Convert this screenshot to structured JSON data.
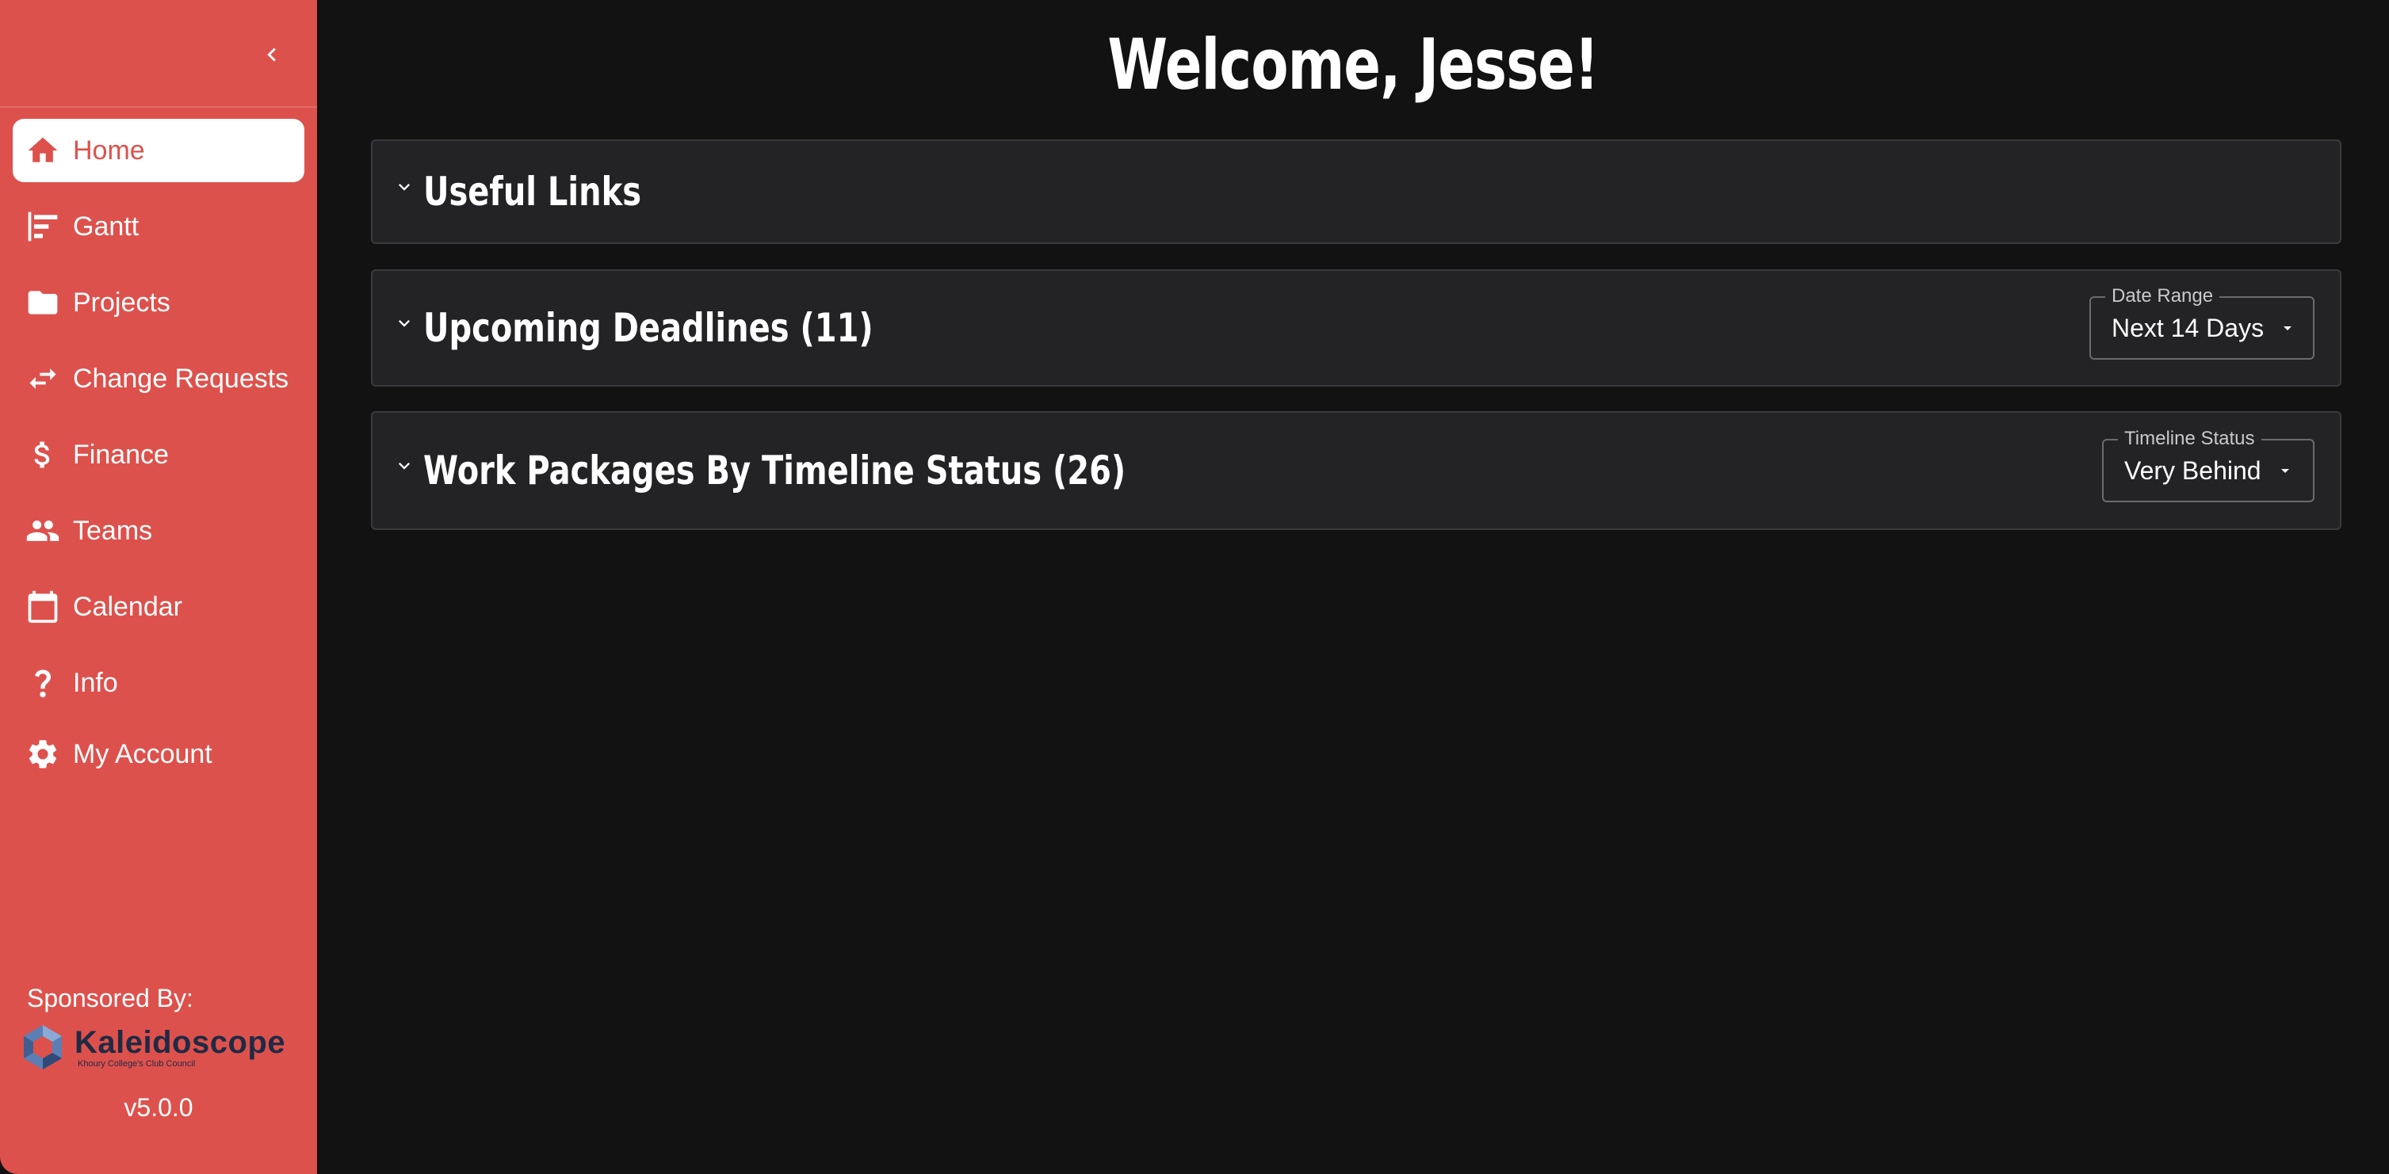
{
  "sidebar": {
    "items": [
      {
        "label": "Home",
        "icon": "home-icon",
        "active": true
      },
      {
        "label": "Gantt",
        "icon": "gantt-icon"
      },
      {
        "label": "Projects",
        "icon": "folder-icon"
      },
      {
        "label": "Change Requests",
        "icon": "swap-arrows-icon"
      },
      {
        "label": "Finance",
        "icon": "dollar-icon"
      },
      {
        "label": "Teams",
        "icon": "people-icon"
      },
      {
        "label": "Calendar",
        "icon": "calendar-icon"
      },
      {
        "label": "Info",
        "icon": "question-icon"
      },
      {
        "label": "My Account",
        "icon": "gear-icon"
      }
    ],
    "sponsor_label": "Sponsored By:",
    "sponsor_name": "Kaleidoscope",
    "sponsor_subtitle": "Khoury College's Club Council",
    "version": "v5.0.0"
  },
  "main": {
    "title": "Welcome, Jesse!",
    "sections": [
      {
        "title": "Useful Links"
      },
      {
        "title": "Upcoming Deadlines (11)",
        "select": {
          "legend": "Date Range",
          "value": "Next 14 Days"
        }
      },
      {
        "title": "Work Packages By Timeline Status (26)",
        "select": {
          "legend": "Timeline Status",
          "value": "Very Behind"
        }
      }
    ]
  },
  "colors": {
    "sidebar_bg": "#dd514c",
    "main_bg": "#121212",
    "card_bg": "#232325",
    "text": "#ffffff"
  }
}
